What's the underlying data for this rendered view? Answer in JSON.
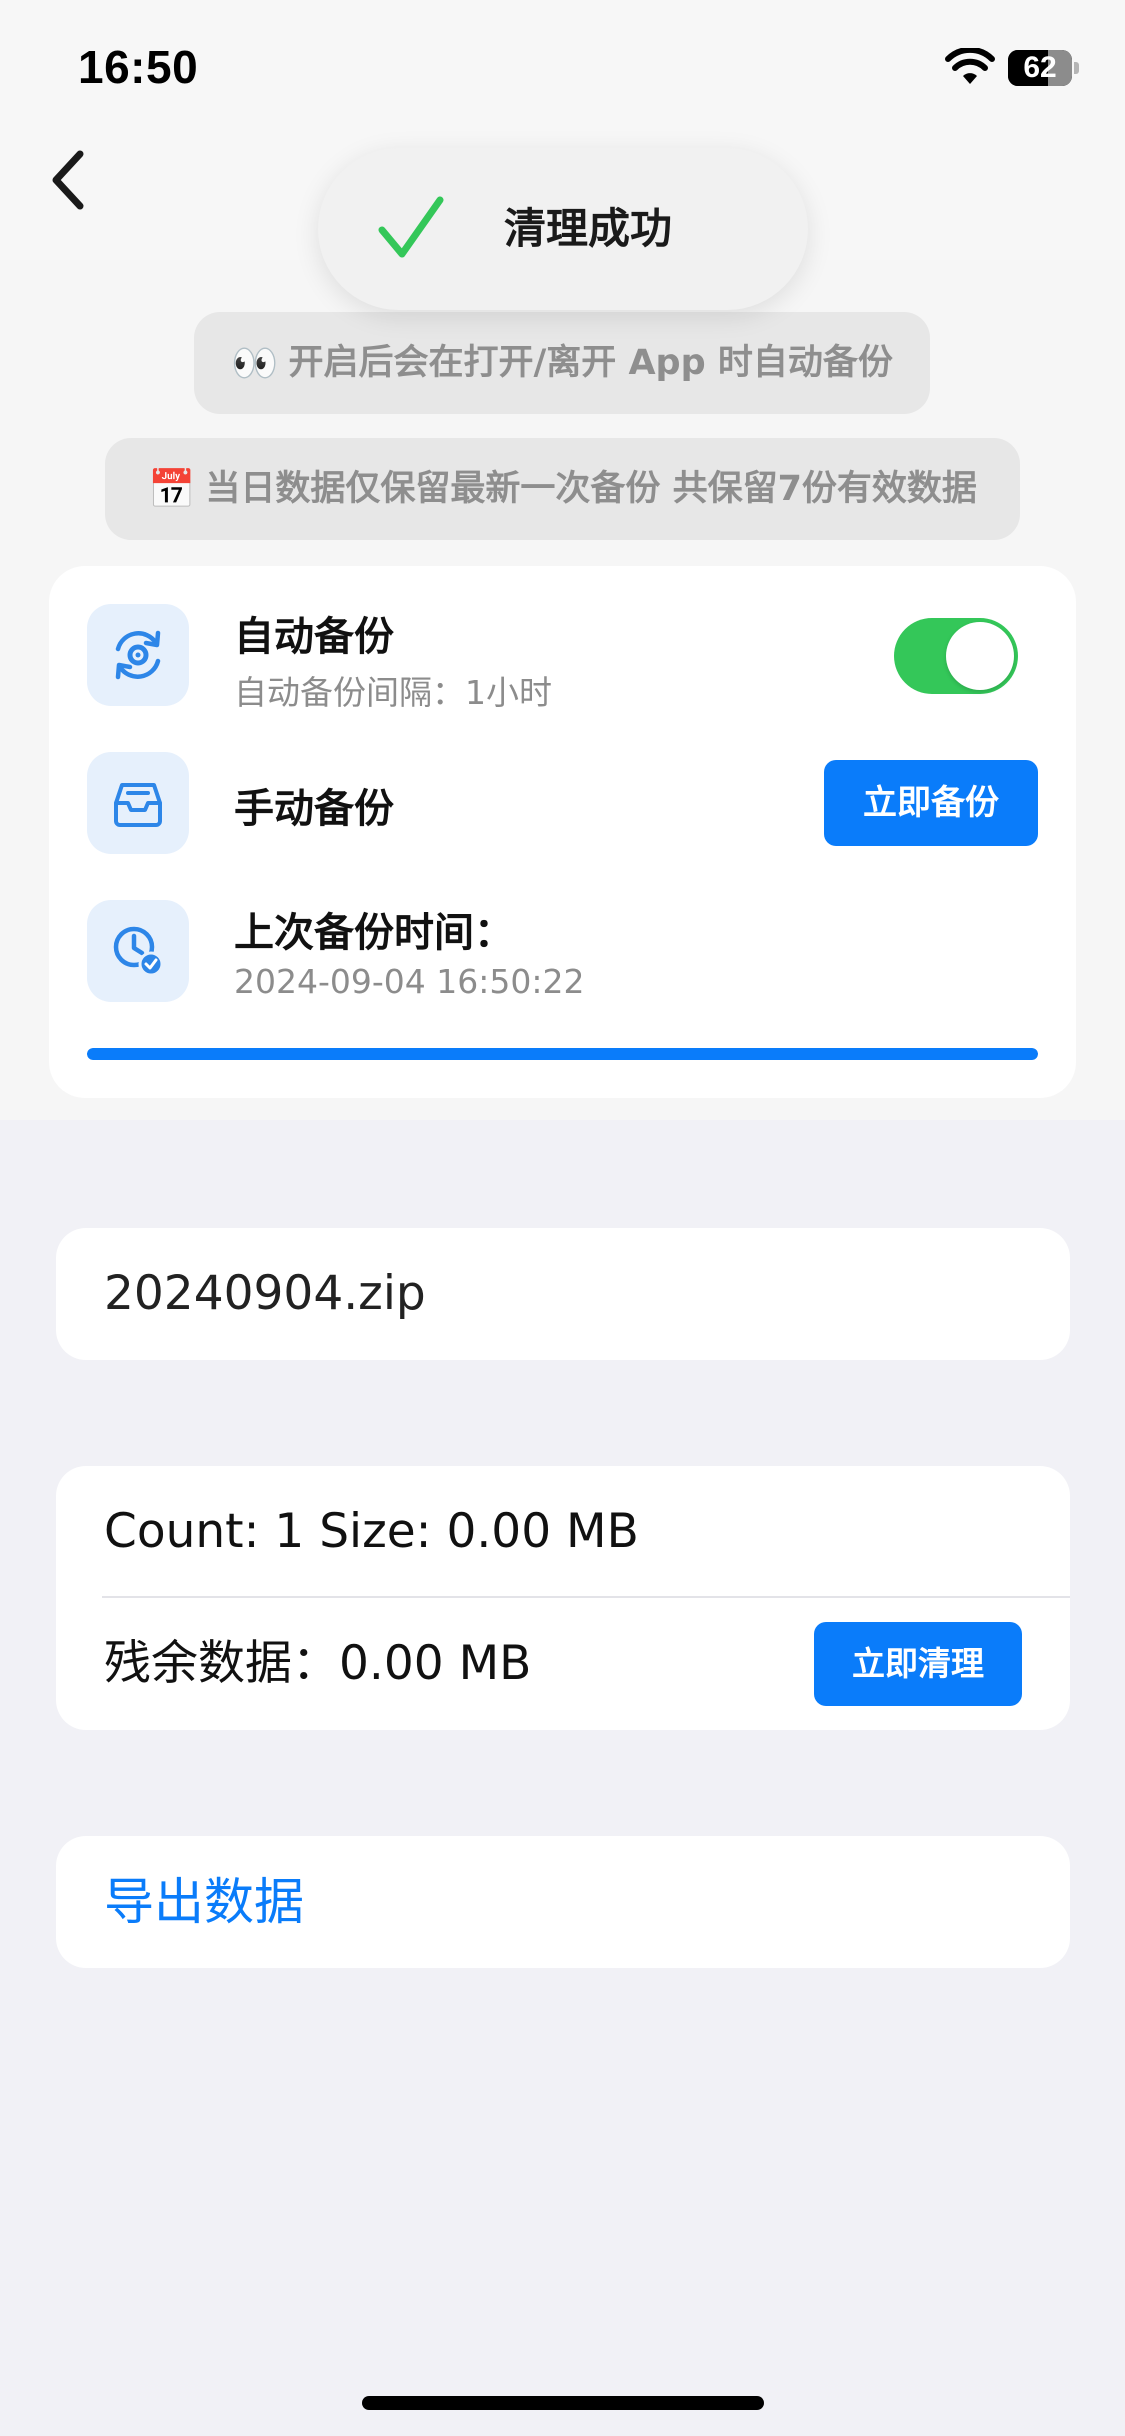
{
  "status_bar": {
    "time": "16:50",
    "battery_text": "62",
    "battery_level_percent": 62
  },
  "nav": {
    "back_icon": "chevron-left-icon"
  },
  "toast": {
    "icon": "checkmark-icon",
    "text": "清理成功",
    "icon_color": "#34c759"
  },
  "info_pills": [
    {
      "emoji": "👀",
      "text": "开启后会在打开/离开 App 时自动备份"
    },
    {
      "emoji": "📅",
      "text": "当日数据仅保留最新一次备份 共保留7份有效数据"
    }
  ],
  "backup_card": {
    "auto_backup": {
      "icon": "auto-sync-gear-icon",
      "title": "自动备份",
      "subtitle": "自动备份间隔：1小时",
      "enabled": true
    },
    "manual_backup": {
      "icon": "inbox-tray-icon",
      "title": "手动备份",
      "button_label": "立即备份"
    },
    "last_backup": {
      "icon": "clock-check-icon",
      "title": "上次备份时间：",
      "value": "2024-09-04 16:50:22"
    },
    "progress_percent": 100
  },
  "file_card": {
    "file_name": "20240904.zip"
  },
  "stats_card": {
    "count_size_text": "Count: 1 Size: 0.00 MB",
    "remaining_text": "残余数据：0.00 MB",
    "clean_button_label": "立即清理"
  },
  "export_card": {
    "label": "导出数据"
  },
  "colors": {
    "accent": "#0a7cfa",
    "toggle_on": "#34c759",
    "background": "#f1f1f6"
  }
}
